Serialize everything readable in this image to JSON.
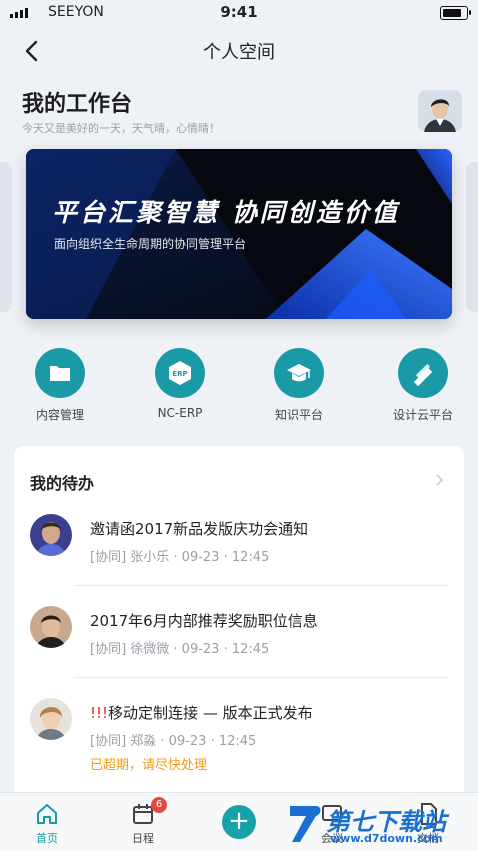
{
  "status_bar": {
    "carrier": "SEEYON",
    "time": "9:41"
  },
  "nav": {
    "title": "个人空间"
  },
  "workspace": {
    "title": "我的工作台",
    "subtitle": "今天又是美好的一天，天气晴，心情晴！"
  },
  "banner": {
    "title": "平台汇聚智慧 协同创造价值",
    "subtitle": "面向组织全生命周期的协同管理平台"
  },
  "apps": [
    {
      "label": "内容管理",
      "icon": "folder-icon"
    },
    {
      "label": "NC-ERP",
      "icon": "erp-icon"
    },
    {
      "label": "知识平台",
      "icon": "graduation-cap-icon"
    },
    {
      "label": "设计云平台",
      "icon": "ruler-pencil-icon"
    }
  ],
  "todo": {
    "title": "我的待办",
    "items": [
      {
        "title": "邀请函2017新品发版庆功会通知",
        "meta": "[协同] 张小乐 · 09-23 · 12:45",
        "alert": "",
        "warning": ""
      },
      {
        "title": "2017年6月内部推荐奖励职位信息",
        "meta": "[协同] 徐微微 · 09-23 · 12:45",
        "alert": "",
        "warning": ""
      },
      {
        "title": "移动定制连接 — 版本正式发布",
        "meta": "[协同] 郑淼 · 09-23 · 12:45",
        "alert": "!!!",
        "warning": "已超期，请尽快处理"
      }
    ]
  },
  "tabbar": {
    "home": "首页",
    "schedule": "日程",
    "schedule_badge": "6",
    "add": "+",
    "meeting": "会议",
    "docs": "文档"
  },
  "watermark": {
    "text": "第七下载站",
    "url": "www.d7down.com"
  },
  "colors": {
    "accent": "#1a9aa6",
    "warning": "#f29a1f",
    "alert": "#e0312b"
  }
}
